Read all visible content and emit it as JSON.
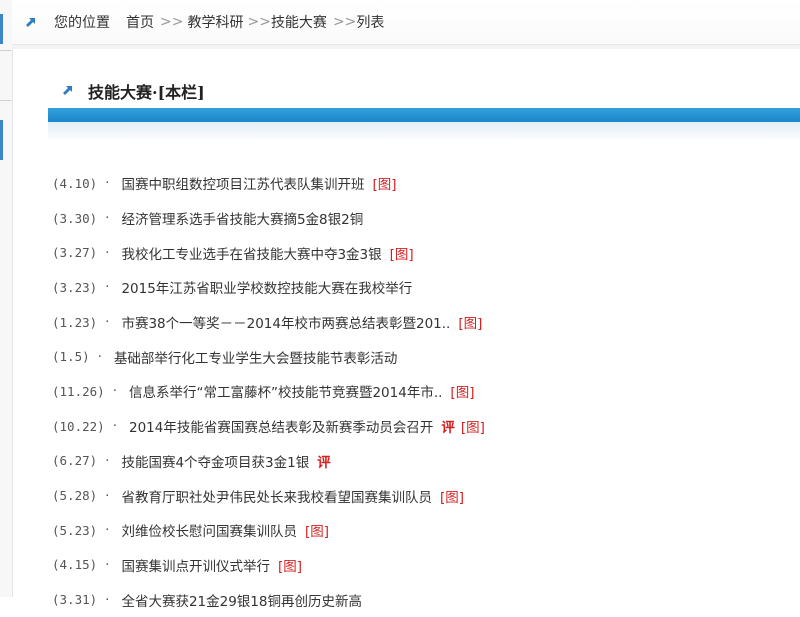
{
  "breadcrumb": {
    "label": "您的位置",
    "home": "首页",
    "sep1": ">>",
    "section": "教学科研",
    "sep2": ">>",
    "category": "技能大赛",
    "sep3": ">>",
    "current": "列表"
  },
  "column": {
    "title": "技能大赛·[本栏]"
  },
  "news": {
    "items": [
      {
        "date": "(4.10)",
        "bullet": "·",
        "title": "国赛中职组数控项目江苏代表队集训开班",
        "img": "[图]",
        "comment": ""
      },
      {
        "date": "(3.30)",
        "bullet": "·",
        "title": "经济管理系选手省技能大赛摘5金8银2铜",
        "img": "",
        "comment": ""
      },
      {
        "date": "(3.27)",
        "bullet": "·",
        "title": "我校化工专业选手在省技能大赛中夺3金3银",
        "img": "[图]",
        "comment": ""
      },
      {
        "date": "(3.23)",
        "bullet": "·",
        "title": "2015年江苏省职业学校数控技能大赛在我校举行",
        "img": "",
        "comment": ""
      },
      {
        "date": "(1.23)",
        "bullet": "·",
        "title": "市赛38个一等奖－－2014年校市两赛总结表彰暨201..",
        "img": "[图]",
        "comment": ""
      },
      {
        "date": "(1.5)",
        "bullet": "·",
        "title": "基础部举行化工专业学生大会暨技能节表彰活动",
        "img": "",
        "comment": ""
      },
      {
        "date": "(11.26)",
        "bullet": "·",
        "title": "信息系举行“常工富藤杯”校技能节竞赛暨2014年市..",
        "img": "[图]",
        "comment": ""
      },
      {
        "date": "(10.22)",
        "bullet": "·",
        "title": "2014年技能省赛国赛总结表彰及新赛季动员会召开",
        "img": "[图]",
        "comment": "评"
      },
      {
        "date": "(6.27)",
        "bullet": "·",
        "title": "技能国赛4个夺金项目获3金1银",
        "img": "",
        "comment": "评"
      },
      {
        "date": "(5.28)",
        "bullet": "·",
        "title": "省教育厅职社处尹伟民处长来我校看望国赛集训队员",
        "img": "[图]",
        "comment": ""
      },
      {
        "date": "(5.23)",
        "bullet": "·",
        "title": "刘维俭校长慰问国赛集训队员",
        "img": "[图]",
        "comment": ""
      },
      {
        "date": "(4.15)",
        "bullet": "·",
        "title": "国赛集训点开训仪式举行",
        "img": "[图]",
        "comment": ""
      },
      {
        "date": "(3.31)",
        "bullet": "·",
        "title": "全省大赛获21金29银18铜再创历史新高",
        "img": "",
        "comment": ""
      }
    ]
  },
  "colors": {
    "accent_blue": "#1b86c9",
    "tag_red": "#d42020"
  },
  "icons": {
    "breadcrumb": "arrow-icon",
    "column_header": "arrow-icon"
  }
}
